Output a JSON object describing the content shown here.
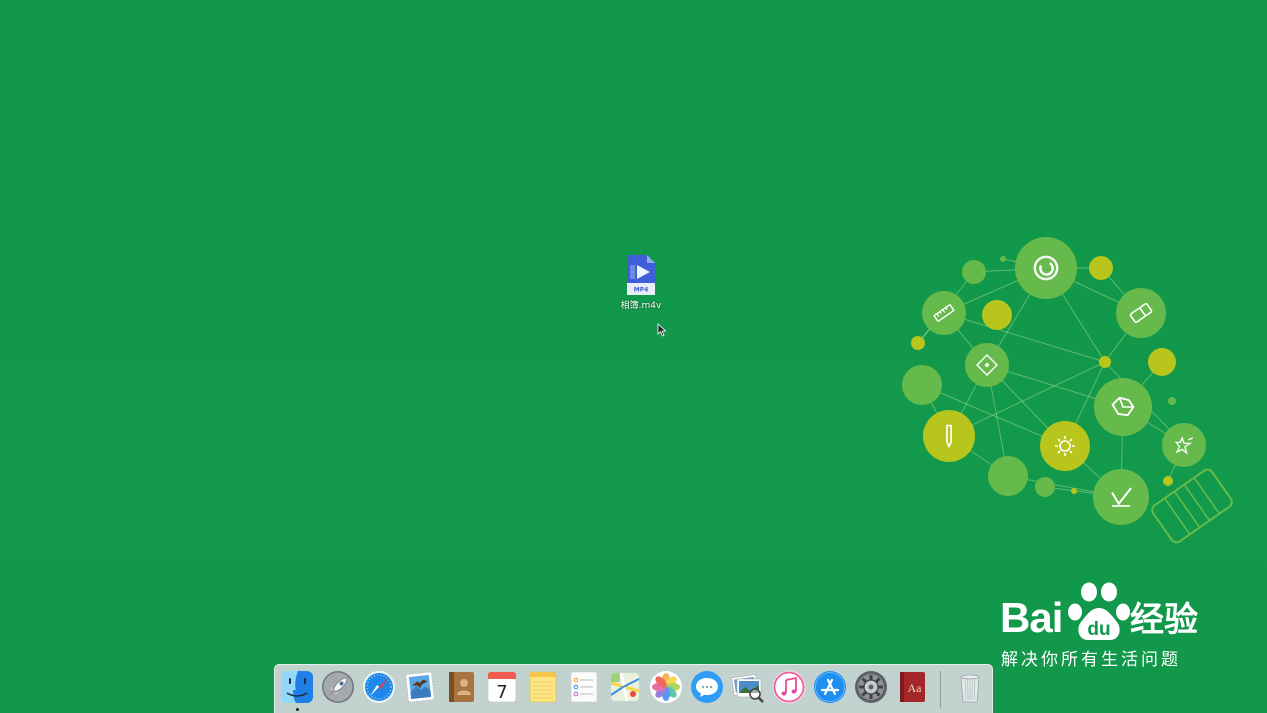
{
  "desktop": {
    "background": "#12984a",
    "files": [
      {
        "name": "相簿.m4v",
        "badge": "MP4",
        "icon": "mp4-file-icon"
      }
    ]
  },
  "wallpaper": {
    "icon": "lightbulb-icon",
    "node_green": "#66ba4b",
    "node_yellow": "#b7c51c",
    "line_color": "#a6dc8e"
  },
  "watermark": {
    "brand": "Bai",
    "paw_text": "du",
    "product": "经验",
    "slogan": "解决你所有生活问题"
  },
  "cursor": {
    "icon": "arrow-cursor-icon"
  },
  "dock": {
    "items": [
      {
        "icon": "finder-icon",
        "running": true
      },
      {
        "icon": "launchpad-icon"
      },
      {
        "icon": "safari-icon"
      },
      {
        "icon": "mail-icon"
      },
      {
        "icon": "contacts-icon"
      },
      {
        "icon": "calendar-icon",
        "day": "7"
      },
      {
        "icon": "notes-icon"
      },
      {
        "icon": "reminders-icon"
      },
      {
        "icon": "maps-icon"
      },
      {
        "icon": "photos-icon"
      },
      {
        "icon": "messages-icon"
      },
      {
        "icon": "preview-icon"
      },
      {
        "icon": "itunes-icon"
      },
      {
        "icon": "app-store-icon"
      },
      {
        "icon": "system-preferences-icon"
      },
      {
        "icon": "dictionary-icon",
        "text": "Aa"
      }
    ],
    "trash": {
      "icon": "trash-icon"
    }
  }
}
